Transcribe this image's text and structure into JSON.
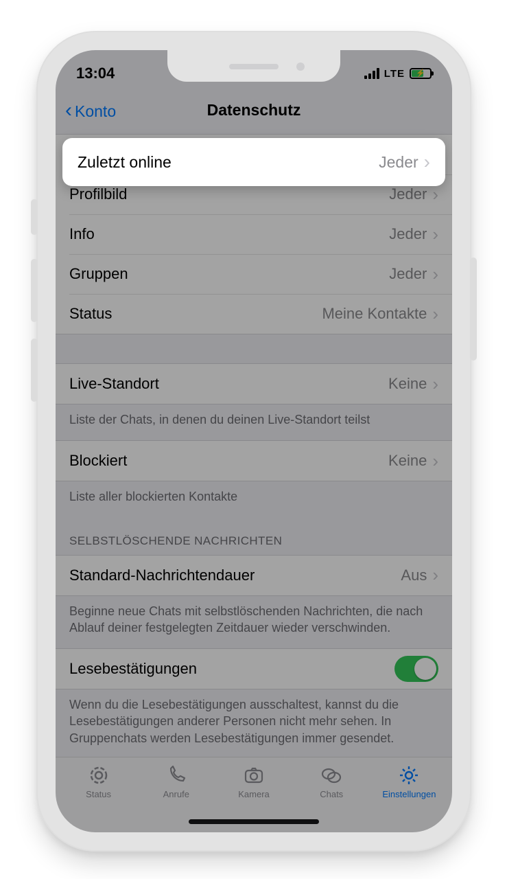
{
  "status": {
    "time": "13:04",
    "network": "LTE"
  },
  "nav": {
    "back": "Konto",
    "title": "Datenschutz"
  },
  "highlighted": {
    "label": "Zuletzt online",
    "value": "Jeder"
  },
  "group1": {
    "items": [
      {
        "label": "Zuletzt online",
        "value": "Jeder"
      },
      {
        "label": "Profilbild",
        "value": "Jeder"
      },
      {
        "label": "Info",
        "value": "Jeder"
      },
      {
        "label": "Gruppen",
        "value": "Jeder"
      },
      {
        "label": "Status",
        "value": "Meine Kontakte"
      }
    ]
  },
  "group2": {
    "items": [
      {
        "label": "Live-Standort",
        "value": "Keine"
      }
    ],
    "footer": "Liste der Chats, in denen du deinen Live-Standort teilst"
  },
  "group3": {
    "items": [
      {
        "label": "Blockiert",
        "value": "Keine"
      }
    ],
    "footer": "Liste aller blockierten Kontakte"
  },
  "group4": {
    "header": "SELBSTLÖSCHENDE NACHRICHTEN",
    "items": [
      {
        "label": "Standard-Nachrichtendauer",
        "value": "Aus"
      }
    ],
    "footer": "Beginne neue Chats mit selbstlöschenden Nachrichten, die nach Ablauf deiner festgelegten Zeitdauer wieder verschwinden."
  },
  "group5": {
    "items": [
      {
        "label": "Lesebestätigungen"
      }
    ],
    "footer": "Wenn du die Lesebestätigungen ausschaltest, kannst du die Lesebestätigungen anderer Personen nicht mehr sehen. In Gruppenchats werden Lesebestätigungen immer gesendet."
  },
  "tabs": {
    "status": "Status",
    "calls": "Anrufe",
    "camera": "Kamera",
    "chats": "Chats",
    "settings": "Einstellungen"
  }
}
